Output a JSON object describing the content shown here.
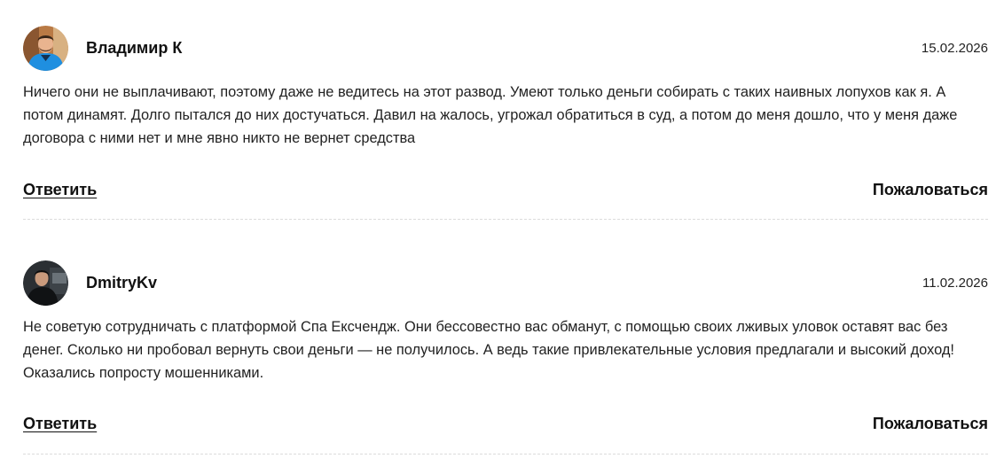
{
  "reviews": [
    {
      "author": "Владимир К",
      "date": "15.02.2026",
      "text": "Ничего они не выплачивают, поэтому даже не ведитесь на этот развод. Умеют только деньги собирать с таких наивных лопухов как я. А потом динамят. Долго пытался до них достучаться. Давил на жалось, угрожал обратиться в суд, а потом до меня дошло, что у меня даже договора с ними нет и мне явно никто не вернет средства",
      "reply_label": "Ответить",
      "complain_label": "Пожаловаться",
      "avatar": {
        "description_icon": "user-photo",
        "accent_color": "#1f8fe0"
      }
    },
    {
      "author": "DmitryKv",
      "date": "11.02.2026",
      "text": "Не советую сотрудничать с платформой Спа Ексчендж. Они бессовестно вас обманут, с помощью своих лживых уловок оставят вас без денег. Сколько ни пробовал вернуть свои деньги — не получилось. А ведь такие привлекательные условия предлагали и высокий доход! Оказались попросту мошенниками.",
      "reply_label": "Ответить",
      "complain_label": "Пожаловаться",
      "avatar": {
        "description_icon": "user-photo",
        "accent_color": "#1b1d1f"
      }
    }
  ]
}
